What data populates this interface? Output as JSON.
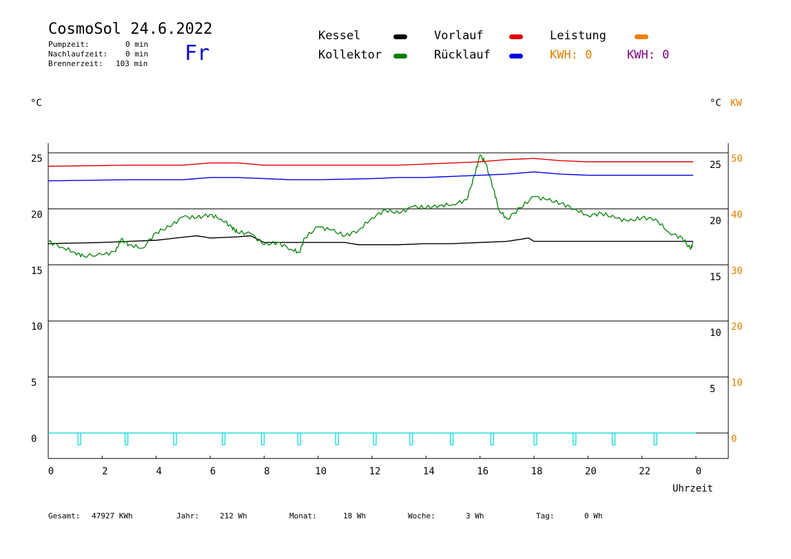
{
  "header": {
    "title": "CosmoSol 24.6.2022",
    "weekday": "Fr",
    "stats": [
      {
        "label": "Pumpzeit:",
        "value": "0 min"
      },
      {
        "label": "Nachlaufzeit:",
        "value": "0 min"
      },
      {
        "label": "Brennerzeit:",
        "value": "103 min"
      }
    ]
  },
  "legend": {
    "items": [
      {
        "label": "Kessel",
        "color": "#000000"
      },
      {
        "label": "Kollektor",
        "color": "#008000"
      },
      {
        "label": "Vorlauf",
        "color": "#e00000"
      },
      {
        "label": "Rücklauf",
        "color": "#0000e0"
      },
      {
        "label": "Leistung",
        "color": "#f08000"
      }
    ],
    "kwh_orange": "KWH: 0",
    "kwh_purple": "KWH: 0",
    "kwh_orange_color": "#e08000",
    "kwh_purple_color": "#800080"
  },
  "axes": {
    "left_unit": "°C",
    "right_unit_c": "°C",
    "right_unit_kw": "KW",
    "kw_color": "#e08000",
    "x_label": "Uhrzeit",
    "left_ticks": [
      "25",
      "20",
      "15",
      "10",
      "5",
      "0"
    ],
    "right_c_ticks": [
      "25",
      "20",
      "15",
      "10",
      "5"
    ],
    "right_kw_ticks": [
      "50",
      "40",
      "30",
      "20",
      "10",
      "0"
    ],
    "x_ticks": [
      "0",
      "2",
      "4",
      "6",
      "8",
      "10",
      "12",
      "14",
      "16",
      "18",
      "20",
      "22",
      "0"
    ]
  },
  "footer": [
    {
      "label": "Gesamt:",
      "value": "47927 KWh"
    },
    {
      "label": "Jahr:",
      "value": "212 Wh"
    },
    {
      "label": "Monat:",
      "value": "18 Wh"
    },
    {
      "label": "Woche:",
      "value": "3 Wh"
    },
    {
      "label": "Tag:",
      "value": "0 Wh"
    }
  ],
  "chart_data": {
    "type": "line",
    "title": "CosmoSol 24.6.2022",
    "xlabel": "Uhrzeit",
    "ylabel": "°C",
    "xlim": [
      0,
      24
    ],
    "ylim": [
      0,
      25
    ],
    "y2lim": [
      0,
      50
    ],
    "y2label": "KW",
    "grid": true,
    "series": [
      {
        "name": "Kessel",
        "color": "#000000",
        "x": [
          0,
          2,
          4,
          5.5,
          6,
          7,
          7.5,
          8,
          9,
          9.5,
          11,
          11.5,
          13,
          14,
          15,
          16,
          17,
          17.8,
          18,
          19,
          20,
          22,
          23.9
        ],
        "y": [
          16.9,
          17.0,
          17.2,
          17.6,
          17.4,
          17.5,
          17.6,
          17.0,
          17.0,
          17.0,
          17.0,
          16.8,
          16.8,
          16.9,
          16.9,
          17.0,
          17.1,
          17.4,
          17.1,
          17.1,
          17.1,
          17.1,
          17.1
        ]
      },
      {
        "name": "Kollektor",
        "color": "#008000",
        "x": [
          0,
          0.5,
          1,
          1.3,
          2,
          2.5,
          2.7,
          3,
          3.5,
          4,
          4.5,
          5,
          5.5,
          6,
          6.4,
          6.8,
          7,
          7.5,
          8,
          8.5,
          9,
          9.3,
          9.5,
          10,
          10.5,
          11,
          11.5,
          12,
          12.5,
          13,
          13.5,
          14,
          14.5,
          15,
          15.5,
          15.8,
          16,
          16.2,
          16.5,
          16.7,
          17,
          17.5,
          18,
          18.5,
          19,
          19.5,
          20,
          20.5,
          21,
          21.5,
          22,
          22.5,
          23,
          23.5,
          23.8,
          23.9
        ],
        "y": [
          17.1,
          16.6,
          16.1,
          15.8,
          15.9,
          16.2,
          17.3,
          16.8,
          16.5,
          17.9,
          18.4,
          19.3,
          19.2,
          19.5,
          19.1,
          18.4,
          17.9,
          17.8,
          16.8,
          17.0,
          16.4,
          16.1,
          17.4,
          18.4,
          18.1,
          17.6,
          18.1,
          19.2,
          19.9,
          19.6,
          20.2,
          20.1,
          20.3,
          20.4,
          20.8,
          23.0,
          24.8,
          24.1,
          21.8,
          19.9,
          19.1,
          20.1,
          21.1,
          20.8,
          20.5,
          20.0,
          19.4,
          19.6,
          19.2,
          18.9,
          19.2,
          19.1,
          17.9,
          17.4,
          16.4,
          17.0
        ]
      },
      {
        "name": "Vorlauf",
        "color": "#e00000",
        "x": [
          0,
          3,
          4,
          5,
          5.5,
          6,
          7,
          8,
          9,
          12,
          13,
          14,
          15,
          16,
          17,
          18,
          19,
          20,
          22,
          23.9
        ],
        "y": [
          23.8,
          23.9,
          23.9,
          23.9,
          24.0,
          24.1,
          24.1,
          23.9,
          23.9,
          23.9,
          23.9,
          24.0,
          24.1,
          24.2,
          24.4,
          24.5,
          24.3,
          24.2,
          24.2,
          24.2
        ]
      },
      {
        "name": "Rücklauf",
        "color": "#0000e0",
        "x": [
          0,
          3,
          4,
          5,
          6,
          7,
          8,
          9,
          10,
          12,
          13,
          14,
          15,
          16,
          17,
          18,
          19,
          20,
          22,
          23.9
        ],
        "y": [
          22.5,
          22.6,
          22.6,
          22.6,
          22.8,
          22.8,
          22.7,
          22.6,
          22.6,
          22.7,
          22.8,
          22.8,
          22.9,
          23.0,
          23.1,
          23.3,
          23.1,
          23.0,
          23.0,
          23.0
        ]
      },
      {
        "name": "Leistung",
        "color": "#00d8d8",
        "x": [
          0,
          24
        ],
        "y": [
          0,
          0
        ]
      }
    ],
    "burner_pulses_h": [
      1.15,
      2.9,
      4.7,
      6.5,
      7.95,
      9.3,
      10.7,
      12.1,
      13.45,
      14.95,
      16.45,
      18.05,
      19.5,
      20.95,
      22.5
    ]
  }
}
